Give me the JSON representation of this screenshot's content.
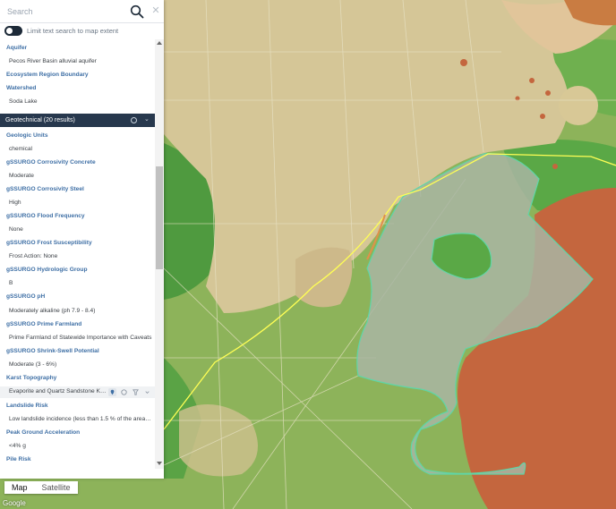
{
  "search": {
    "placeholder": "Search"
  },
  "toggle": {
    "label": "Limit text search to map extent",
    "on": true
  },
  "rows_top": [
    {
      "kind": "label",
      "text": "Aquifer"
    },
    {
      "kind": "value",
      "text": "Pecos River Basin alluvial aquifer"
    },
    {
      "kind": "label",
      "text": "Ecosystem Region Boundary"
    },
    {
      "kind": "label",
      "text": "Watershed"
    },
    {
      "kind": "value",
      "text": "Soda Lake"
    }
  ],
  "group": {
    "title": "Geotechnical (20 results)"
  },
  "rows_geo": [
    {
      "kind": "label",
      "text": "Geologic Units"
    },
    {
      "kind": "value",
      "text": "chemical"
    },
    {
      "kind": "label",
      "text": "gSSURGO Corrosivity Concrete"
    },
    {
      "kind": "value",
      "text": "Moderate"
    },
    {
      "kind": "label",
      "text": "gSSURGO Corrosivity Steel"
    },
    {
      "kind": "value",
      "text": "High"
    },
    {
      "kind": "label",
      "text": "gSSURGO Flood Frequency"
    },
    {
      "kind": "value",
      "text": "None"
    },
    {
      "kind": "label",
      "text": "gSSURGO Frost Susceptibility"
    },
    {
      "kind": "value",
      "text": "Frost Action: None"
    },
    {
      "kind": "label",
      "text": "gSSURGO Hydrologic Group"
    },
    {
      "kind": "value",
      "text": "B"
    },
    {
      "kind": "label",
      "text": "gSSURGO pH"
    },
    {
      "kind": "value",
      "text": "Moderately alkaline (ph 7.9 - 8.4)"
    },
    {
      "kind": "label",
      "text": "gSSURGO Prime Farmland"
    },
    {
      "kind": "value",
      "text": "Prime Farmland of Statewide Importance with Caveats"
    },
    {
      "kind": "label",
      "text": "gSSURGO Shrink-Swell Potential"
    },
    {
      "kind": "value",
      "text": "Moderate (3 - 6%)"
    },
    {
      "kind": "label",
      "text": "Karst Topography"
    },
    {
      "kind": "value",
      "text": "Evaporite and Quartz Sandstone Karst"
    },
    {
      "kind": "label",
      "text": "Landslide Risk"
    },
    {
      "kind": "value",
      "text": "Low landslide incidence (less than 1.5 % of the area is involved)"
    },
    {
      "kind": "label",
      "text": "Peak Ground Acceleration"
    },
    {
      "kind": "value",
      "text": "<4% g"
    },
    {
      "kind": "label",
      "text": "Pile Risk"
    }
  ],
  "map_type": {
    "map": "Map",
    "satellite": "Satellite",
    "active": "Map"
  },
  "logo": "Google",
  "colors": {
    "panel_header": "#27384d",
    "label_blue": "#3e6fa5",
    "map_green": "#8db35a",
    "map_tan": "#d7c89a",
    "soil_orange": "#c4663e",
    "boundary_yellow": "#ffff55",
    "polygon_teal": "#5fd6a7"
  }
}
